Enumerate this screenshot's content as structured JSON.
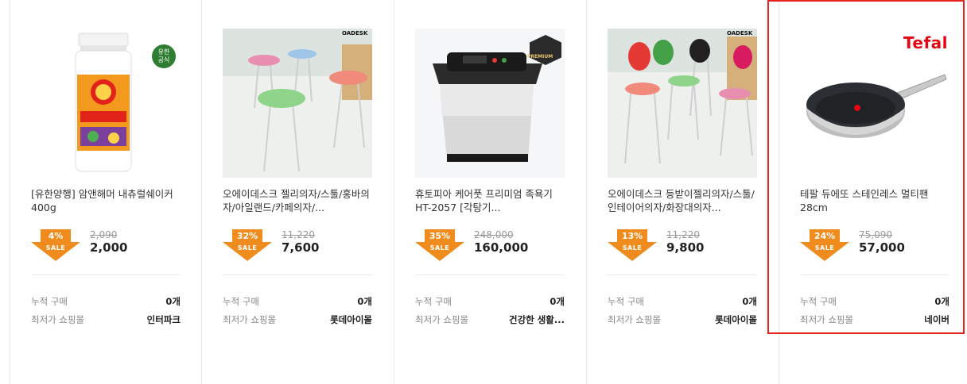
{
  "products": [
    {
      "title": "[유한양행] 암앤해머 내츄럴쉐이커 400g",
      "discount": "4%",
      "sale": "SALE",
      "original_price": "2,090",
      "price": "2,000",
      "purchases_label": "누적 구매",
      "purchases_value": "0개",
      "lowest_mall_label": "최저가 쇼핑몰",
      "lowest_mall_value": "인터파크"
    },
    {
      "title": "오에이데스크 젤리의자/스툴/홍바의자/아일랜드/카페의자/...",
      "discount": "32%",
      "sale": "SALE",
      "original_price": "11,220",
      "price": "7,600",
      "purchases_label": "누적 구매",
      "purchases_value": "0개",
      "lowest_mall_label": "최저가 쇼핑몰",
      "lowest_mall_value": "롯데아이몰",
      "brand_tag": "OADESK"
    },
    {
      "title": "휴토피아 케어풋 프리미엄 족욕기 HT-2057 [각탕기...",
      "discount": "35%",
      "sale": "SALE",
      "original_price": "248,000",
      "price": "160,000",
      "purchases_label": "누적 구매",
      "purchases_value": "0개",
      "lowest_mall_label": "최저가 쇼핑몰",
      "lowest_mall_value": "건강한 생활...",
      "brand_tag": "PREMIUM"
    },
    {
      "title": "오에이데스크 등받이젤리의자/스툴/인테이어의자/화장대의자...",
      "discount": "13%",
      "sale": "SALE",
      "original_price": "11,220",
      "price": "9,800",
      "purchases_label": "누적 구매",
      "purchases_value": "0개",
      "lowest_mall_label": "최저가 쇼핑몰",
      "lowest_mall_value": "롯데아이몰",
      "brand_tag": "OADESK"
    },
    {
      "title": "테팔 듀에또 스테인레스 멀티팬 28cm",
      "discount": "24%",
      "sale": "SALE",
      "original_price": "75,090",
      "price": "57,000",
      "purchases_label": "누적 구매",
      "purchases_value": "0개",
      "lowest_mall_label": "최저가 쇼핑몰",
      "lowest_mall_value": "네이버",
      "brand_logo": "Tefal"
    }
  ],
  "colors": {
    "badge": "#f08c1e",
    "selected_border": "#e6231f",
    "tefal": "#e30613"
  }
}
